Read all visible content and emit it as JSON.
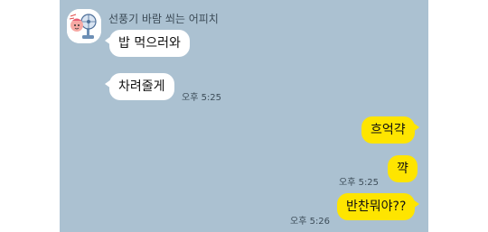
{
  "sender": {
    "name": "선풍기 바람 쐬는 어피치",
    "avatar": "fan-character-avatar"
  },
  "messages": {
    "m1": {
      "text": "밥 먹으러와"
    },
    "m2": {
      "text": "차려줄게",
      "time": "오후 5:25"
    },
    "m3": {
      "text": "흐억갹"
    },
    "m4": {
      "text": "꺅",
      "time": "오후 5:25"
    },
    "m5": {
      "text": "반찬뭐야??",
      "time": "오후 5:26"
    }
  },
  "colors": {
    "chat_background": "#abc1d1",
    "incoming_bubble": "#ffffff",
    "outgoing_bubble": "#fee500"
  },
  "edge_text": ""
}
